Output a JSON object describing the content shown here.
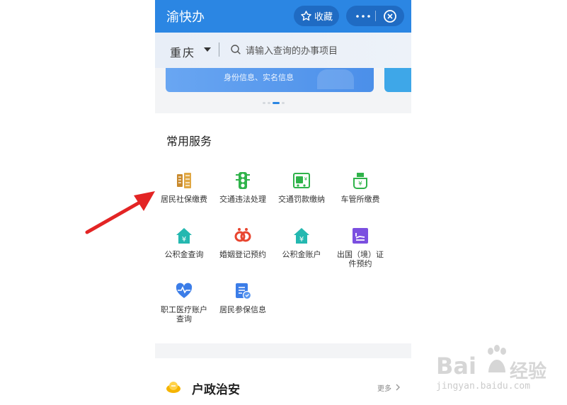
{
  "header": {
    "app_title": "渝快办",
    "favorite_label": "收藏"
  },
  "search": {
    "city": "重庆",
    "placeholder": "请输入查询的办事项目"
  },
  "banner": {
    "text": "身份信息、实名信息"
  },
  "common_services": {
    "title": "常用服务",
    "items": [
      {
        "label": "居民社保缴费",
        "icon": "tax-icon",
        "color": "#c98a2e"
      },
      {
        "label": "交通违法处理",
        "icon": "traffic-light-icon",
        "color": "#2fb34a"
      },
      {
        "label": "交通罚款缴纳",
        "icon": "fine-payment-icon",
        "color": "#2fb34a"
      },
      {
        "label": "车管所缴费",
        "icon": "vehicle-office-icon",
        "color": "#2fb34a"
      },
      {
        "label": "公积金查询",
        "icon": "housing-fund-icon",
        "color": "#24b8b0"
      },
      {
        "label": "婚姻登记预约",
        "icon": "marriage-icon",
        "color": "#e8452f"
      },
      {
        "label": "公积金账户",
        "icon": "housing-fund-account-icon",
        "color": "#24b8b0"
      },
      {
        "label": "出国（境）证件预约",
        "label_line1": "出国（境）证",
        "label_line2": "件预约",
        "icon": "passport-icon",
        "color": "#7b4fe0"
      },
      {
        "label": "职工医疗账户查询",
        "label_line1": "职工医疗账户",
        "label_line2": "查询",
        "icon": "heart-pulse-icon",
        "color": "#3b7de8"
      },
      {
        "label": "居民参保信息",
        "icon": "insurance-doc-icon",
        "color": "#3b7de8"
      }
    ]
  },
  "household_security": {
    "title": "户政治安",
    "more_label": "更多",
    "icon": "police-badge-icon"
  },
  "watermark": {
    "brand": "Bai",
    "brand_suffix": "经验",
    "url": "jingyan.baidu.com"
  },
  "colors": {
    "titlebar": "#2b86e3",
    "arrow": "#e32424"
  }
}
